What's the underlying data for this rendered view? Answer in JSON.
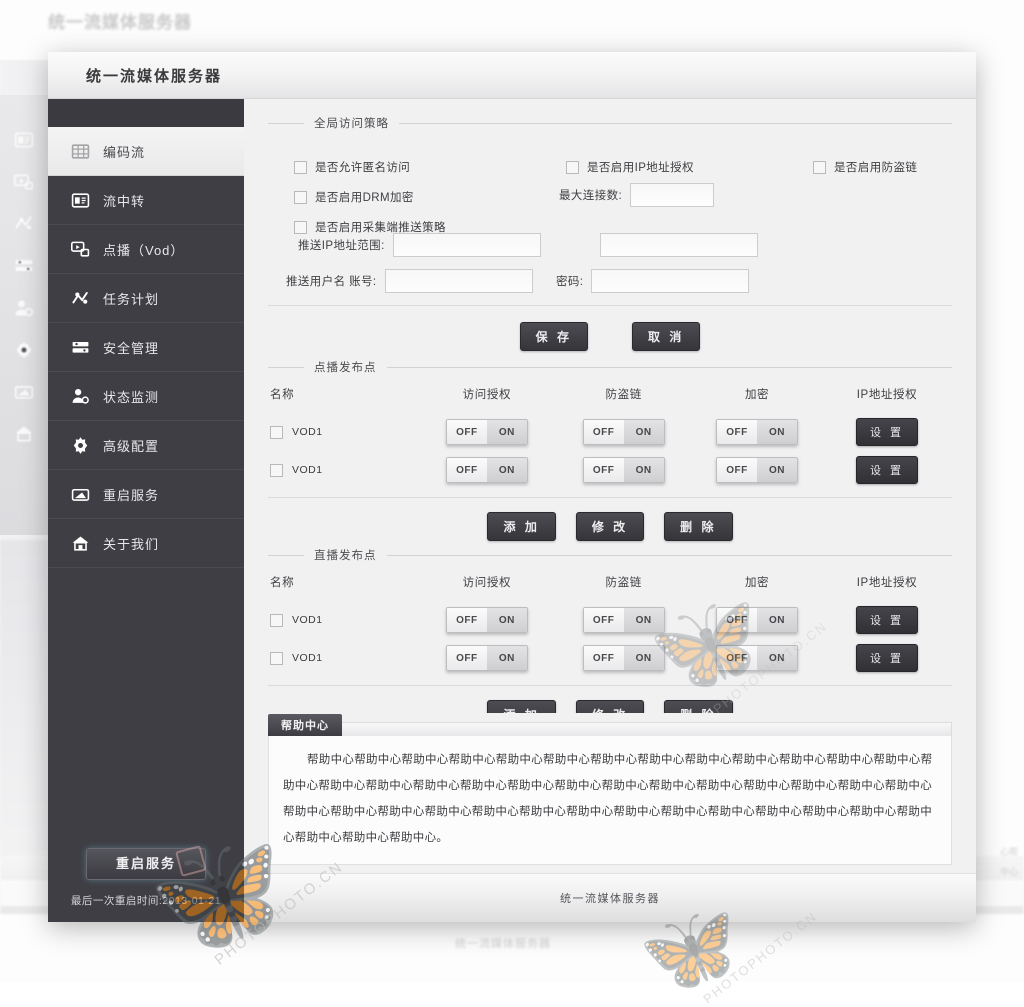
{
  "app": {
    "title": "统一流媒体服务器",
    "bg_title": "统一流媒体服务器",
    "footer": "统一流媒体服务器",
    "bg_footer": "统一流媒体服务器"
  },
  "sidebar": {
    "items": [
      {
        "label": "编码流",
        "icon": "grid-stream-icon",
        "active": true
      },
      {
        "label": "流中转",
        "icon": "relay-window-icon",
        "active": false
      },
      {
        "label": "点播（Vod）",
        "icon": "vod-screen-icon",
        "active": false
      },
      {
        "label": "任务计划",
        "icon": "task-plan-icon",
        "active": false
      },
      {
        "label": "安全管理",
        "icon": "security-icon",
        "active": false
      },
      {
        "label": "状态监测",
        "icon": "user-monitor-icon",
        "active": false
      },
      {
        "label": "高级配置",
        "icon": "gear-icon",
        "active": false
      },
      {
        "label": "重启服务",
        "icon": "restart-icon",
        "active": false
      },
      {
        "label": "关于我们",
        "icon": "home-about-icon",
        "active": false
      }
    ],
    "restart_button": "重启服务",
    "restart_time": "最后一次重启时间:2013-01-21"
  },
  "global_policy": {
    "legend": "全局访问策略",
    "checkboxes": [
      {
        "label": "是否允许匿名访问",
        "checked": false
      },
      {
        "label": "是否启用DRM加密",
        "checked": false
      },
      {
        "label": "是否启用采集端推送策略",
        "checked": false
      },
      {
        "label": "是否启用IP地址授权",
        "checked": false
      },
      {
        "label": "是否启用防盗链",
        "checked": false
      }
    ],
    "max_conn_label": "最大连接数:",
    "max_conn_value": "",
    "push_ip_label": "推送IP地址范围:",
    "push_ip_value": "",
    "push_ip_value2": "",
    "push_user_label": "推送用户名  账号:",
    "push_user_value": "",
    "password_label": "密码:",
    "password_value": "",
    "save_label": "保 存",
    "cancel_label": "取 消"
  },
  "vod_section": {
    "legend": "点播发布点",
    "columns": [
      "名称",
      "访问授权",
      "防盗链",
      "加密",
      "IP地址授权"
    ],
    "rows": [
      {
        "name": "VOD1",
        "checked": false,
        "access": "off",
        "antileech": "off",
        "encrypt": "off",
        "set_label": "设 置"
      },
      {
        "name": "VOD1",
        "checked": false,
        "access": "off",
        "antileech": "off",
        "encrypt": "off",
        "set_label": "设 置"
      }
    ],
    "actions": [
      "添 加",
      "修 改",
      "删 除"
    ]
  },
  "live_section": {
    "legend": "直播发布点",
    "columns": [
      "名称",
      "访问授权",
      "防盗链",
      "加密",
      "IP地址授权"
    ],
    "rows": [
      {
        "name": "VOD1",
        "checked": false,
        "access": "off",
        "antileech": "off",
        "encrypt": "off",
        "set_label": "设 置"
      },
      {
        "name": "VOD1",
        "checked": false,
        "access": "off",
        "antileech": "off",
        "encrypt": "off",
        "set_label": "设 置"
      }
    ],
    "actions": [
      "添 加",
      "修 改",
      "删 除"
    ]
  },
  "toggle": {
    "off_label": "OFF",
    "on_label": "ON"
  },
  "help": {
    "tab": "帮助中心",
    "text": "帮助中心帮助中心帮助中心帮助中心帮助中心帮助中心帮助中心帮助中心帮助中心帮助中心帮助中心帮助中心帮助中心帮助中心帮助中心帮助中心帮助中心帮助中心帮助中心帮助中心帮助中心帮助中心帮助中心帮助中心帮助中心帮助中心帮助中心帮助中心帮助中心帮助中心帮助中心帮助中心帮助中心帮助中心帮助中心帮助中心帮助中心帮助中心帮助中心帮助中心帮助中心帮助中心帮助中心帮助中心。"
  },
  "watermark": {
    "text1": "PHOTOPHOTO.CN",
    "text2": "PHOTOPHOTO.CN",
    "text3": "PHOTOPHOTO.CN"
  },
  "colors": {
    "sidebar": "#3e3e44",
    "window": "#f0f0f1",
    "accent": "#35353a"
  }
}
